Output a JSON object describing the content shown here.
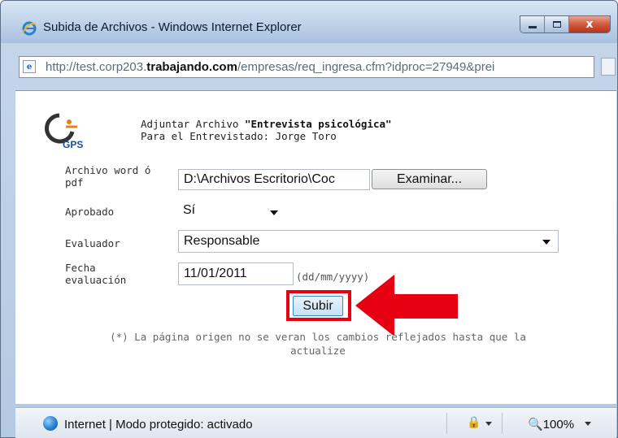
{
  "window": {
    "title": "Subida de Archivos - Windows Internet Explorer",
    "close_label": "x"
  },
  "addressbar": {
    "url_prefix": "http://test.corp203.",
    "url_domain": "trabajando.com",
    "url_suffix": "/empresas/req_ingresa.cfm?idproc=27949&prei"
  },
  "form": {
    "intro_line1_prefix": "Adjuntar Archivo ",
    "intro_line1_bold": "\"Entrevista psicológica\"",
    "intro_line2": "Para el Entrevistado: Jorge Toro",
    "file_label_1": "Archivo word ó",
    "file_label_2": "pdf",
    "file_value": "D:\\Archivos Escritorio\\Coc",
    "examinar_label": "Examinar...",
    "aprobado_label": "Aprobado",
    "aprobado_value": "Sí",
    "evaluador_label": "Evaluador",
    "evaluador_value": "Responsable",
    "fecha_label_1": "Fecha",
    "fecha_label_2": "evaluación",
    "fecha_value": "11/01/2011",
    "fecha_hint": "(dd/mm/yyyy)",
    "submit_label": "Subir",
    "note_line1": "(*) La página origen no se veran los cambios reflejados hasta que la",
    "note_line2": "actualize"
  },
  "status": {
    "text": "Internet | Modo protegido: activado",
    "zoom": "100%"
  },
  "colors": {
    "highlight": "#e60012"
  }
}
